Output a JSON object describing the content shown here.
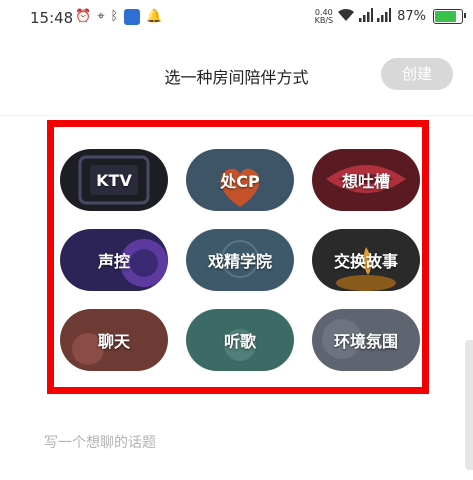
{
  "status_bar": {
    "time": "15:48",
    "net_speed_value": "0.40",
    "net_speed_unit": "KB/S",
    "battery_percent": "87%",
    "battery_level": 0.87
  },
  "header": {
    "title": "选一种房间陪伴方式",
    "create_label": "创建"
  },
  "modes": [
    {
      "label": "KTV"
    },
    {
      "label": "处CP"
    },
    {
      "label": "想吐槽"
    },
    {
      "label": "声控"
    },
    {
      "label": "戏精学院"
    },
    {
      "label": "交换故事"
    },
    {
      "label": "聊天"
    },
    {
      "label": "听歌"
    },
    {
      "label": "环境氛围"
    }
  ],
  "topic": {
    "placeholder": "写一个想聊的话题"
  },
  "colors": {
    "frame": "#f40000",
    "create_btn": "#d8d8d8",
    "battery": "#3ac14a"
  }
}
